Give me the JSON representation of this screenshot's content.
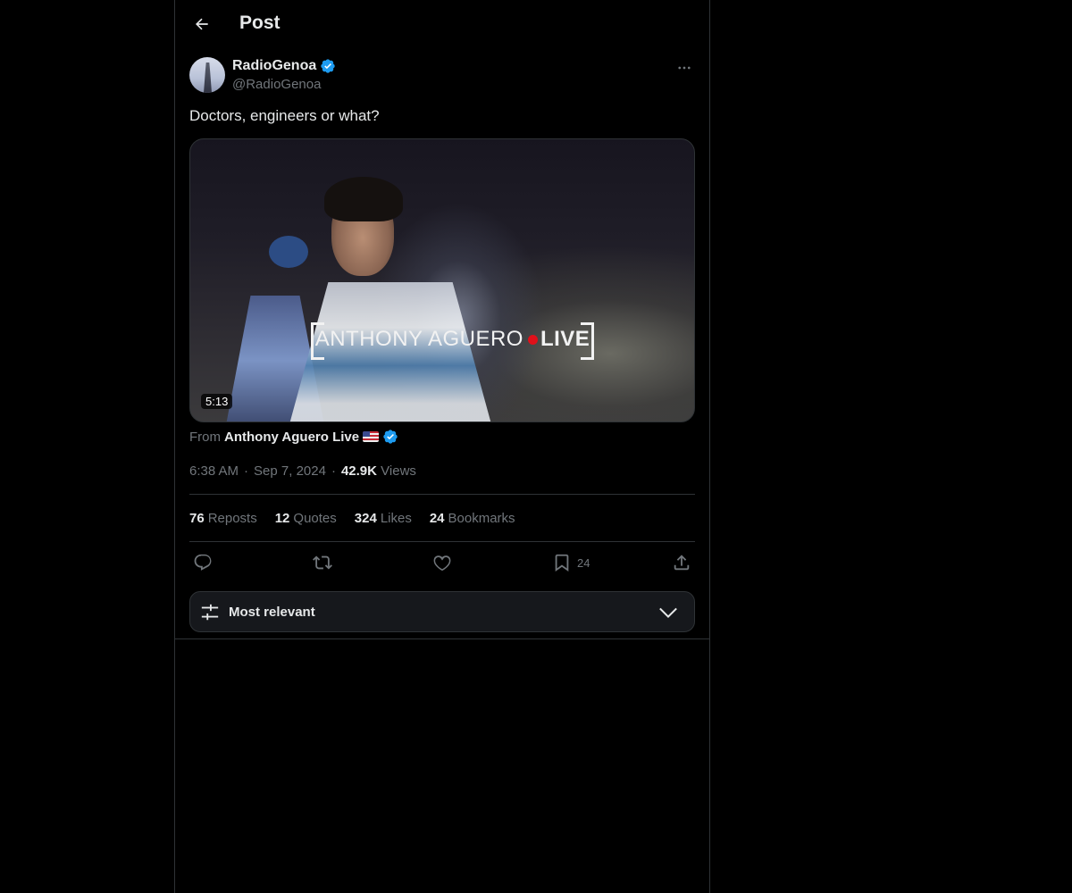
{
  "header": {
    "title": "Post"
  },
  "post": {
    "author": {
      "name": "RadioGenoa",
      "handle": "@RadioGenoa",
      "verified": true
    },
    "text": "Doctors, engineers or what?",
    "media": {
      "watermark_left": "ANTHONY AGUERO",
      "watermark_right": "LIVE",
      "duration": "5:13"
    },
    "source": {
      "prefix": "From",
      "name": "Anthony Aguero Live"
    },
    "meta": {
      "time": "6:38 AM",
      "separator": "·",
      "date": "Sep 7, 2024",
      "views_count": "42.9K",
      "views_label": "Views"
    },
    "stats": [
      {
        "count": "76",
        "label": "Reposts"
      },
      {
        "count": "12",
        "label": "Quotes"
      },
      {
        "count": "324",
        "label": "Likes"
      },
      {
        "count": "24",
        "label": "Bookmarks"
      }
    ],
    "actions": {
      "bookmark_count": "24"
    }
  },
  "sort": {
    "label": "Most relevant"
  },
  "colors": {
    "background": "#000000",
    "text": "#e7e9ea",
    "muted": "#71767b",
    "border": "#2f3336",
    "verified": "#1d9bf0",
    "sort_bg": "#16181c"
  }
}
